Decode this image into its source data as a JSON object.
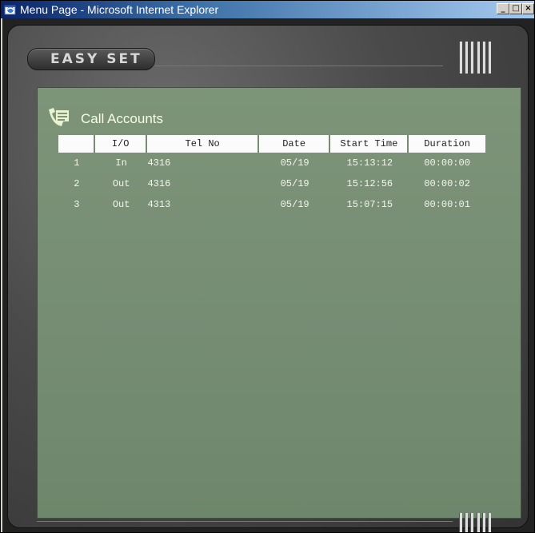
{
  "window": {
    "title": "Menu Page - Microsoft Internet Explorer",
    "minimize": "_",
    "maximize": "□",
    "close": "×"
  },
  "brand": {
    "logo_text": "EASY SET"
  },
  "section": {
    "title": "Call Accounts"
  },
  "table": {
    "headers": {
      "num": "",
      "io": "I/O",
      "tel": "Tel No",
      "date": "Date",
      "start": "Start Time",
      "duration": "Duration"
    },
    "rows": [
      {
        "num": "1",
        "io": "In",
        "tel": "4316",
        "date": "05/19",
        "start": "15:13:12",
        "duration": "00:00:00"
      },
      {
        "num": "2",
        "io": "Out",
        "tel": "4316",
        "date": "05/19",
        "start": "15:12:56",
        "duration": "00:00:02"
      },
      {
        "num": "3",
        "io": "Out",
        "tel": "4313",
        "date": "05/19",
        "start": "15:07:15",
        "duration": "00:00:01"
      }
    ]
  },
  "colors": {
    "screen": "#7d9479",
    "header_bg": "#fbfbfb",
    "title_text": "#f7fde8"
  }
}
